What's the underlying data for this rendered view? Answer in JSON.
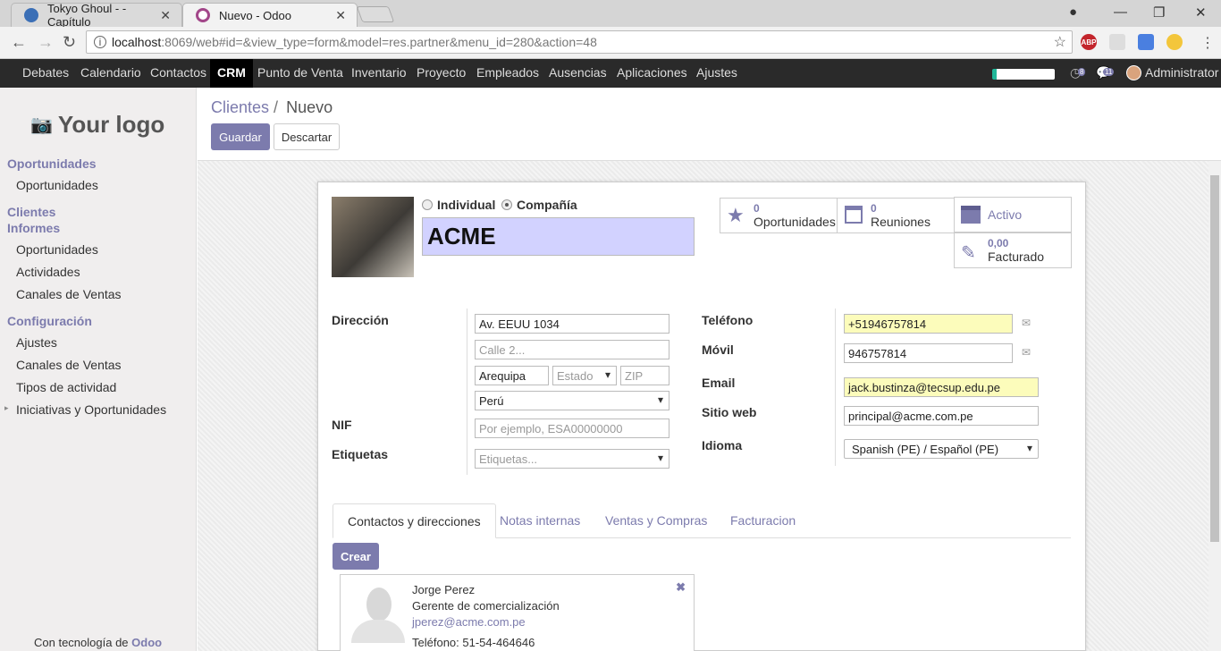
{
  "browser": {
    "tabs": [
      {
        "title": "Tokyo Ghoul - - Capítulo",
        "close": "✕"
      },
      {
        "title": "Nuevo - Odoo",
        "close": "✕"
      }
    ],
    "url_host": "localhost",
    "url_path": ":8069/web#id=&view_type=form&model=res.partner&menu_id=280&action=48",
    "extensions": [
      "ABP"
    ]
  },
  "topnav": {
    "items": [
      "Debates",
      "Calendario",
      "Contactos",
      "CRM",
      "Punto de Venta",
      "Inventario",
      "Proyecto",
      "Empleados",
      "Ausencias",
      "Aplicaciones",
      "Ajustes"
    ],
    "active": "CRM",
    "activity_count": "8",
    "message_count": "11",
    "user": "Administrator"
  },
  "sidebar": {
    "logo": "Your logo",
    "sections": [
      {
        "heading": "Oportunidades",
        "items": [
          "Oportunidades"
        ]
      },
      {
        "heading": "Clientes",
        "items": []
      },
      {
        "heading": "Informes",
        "items": [
          "Oportunidades",
          "Actividades",
          "Canales de Ventas"
        ]
      },
      {
        "heading": "Configuración",
        "items": [
          "Ajustes",
          "Canales de Ventas",
          "Tipos de actividad",
          "Iniciativas y Oportunidades"
        ]
      }
    ],
    "footer_prefix": "Con tecnología de ",
    "footer_brand": "Odoo"
  },
  "breadcrumb": {
    "parent": "Clientes",
    "sep": "/",
    "current": "Nuevo"
  },
  "actions": {
    "save": "Guardar",
    "discard": "Descartar"
  },
  "form": {
    "type_individual": "Individual",
    "type_company": "Compañía",
    "name": "ACME",
    "stats": [
      {
        "num": "0",
        "label": "Oportunidades"
      },
      {
        "num": "0",
        "label": "Reuniones"
      },
      {
        "num": "",
        "label": "Activo"
      },
      {
        "num": "0,00",
        "label": "Facturado"
      }
    ],
    "labels": {
      "address": "Dirección",
      "nif": "NIF",
      "tags": "Etiquetas",
      "phone": "Teléfono",
      "mobile": "Móvil",
      "email": "Email",
      "website": "Sitio web",
      "language": "Idioma"
    },
    "street": "Av. EEUU 1034",
    "street2_placeholder": "Calle 2...",
    "city": "Arequipa",
    "state_placeholder": "Estado",
    "zip_placeholder": "ZIP",
    "country": "Perú",
    "nif_placeholder": "Por ejemplo, ESA00000000",
    "tags_placeholder": "Etiquetas...",
    "phone": "+51946757814",
    "mobile": "946757814",
    "email": "jack.bustinza@tecsup.edu.pe",
    "website": "principal@acme.com.pe",
    "language": "Spanish (PE) / Español (PE)"
  },
  "tabs": [
    "Contactos y direcciones",
    "Notas internas",
    "Ventas y Compras",
    "Facturacion"
  ],
  "create_label": "Crear",
  "contact_card": {
    "name": "Jorge Perez",
    "title": "Gerente de comercialización",
    "email": "jperez@acme.com.pe",
    "phone": "Teléfono: 51-54-464646"
  },
  "colors": {
    "brand": "#7c7bad",
    "nav": "#2a2a2a",
    "required": "#fcfcbb"
  }
}
